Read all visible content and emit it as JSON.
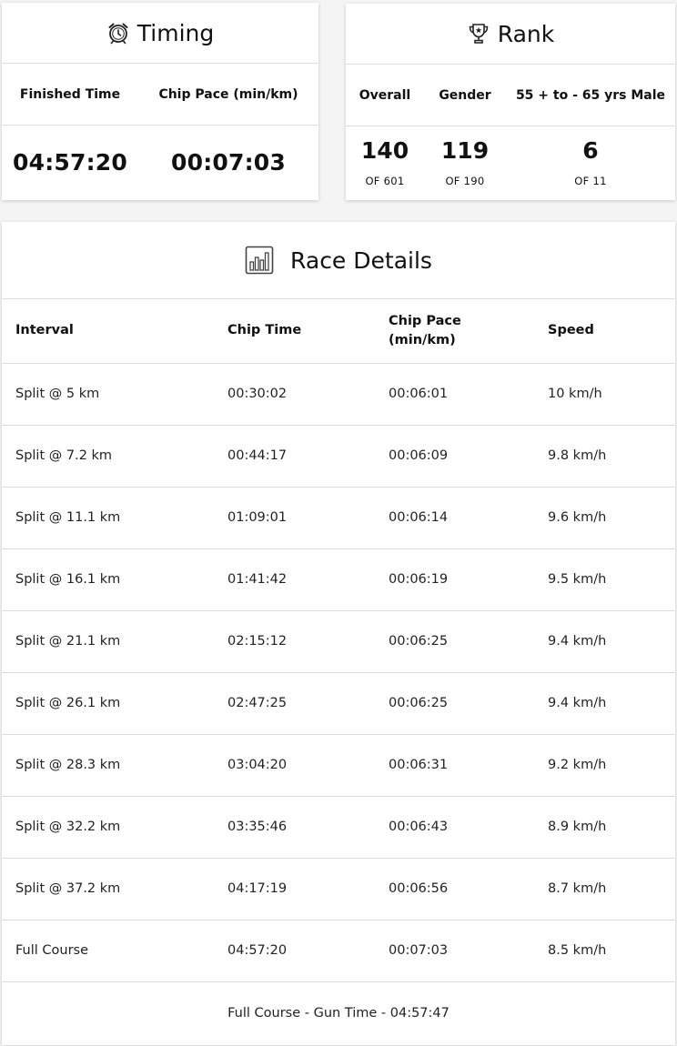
{
  "timing": {
    "title": "Timing",
    "icon": "alarm-clock-icon",
    "finished_time_label": "Finished Time",
    "chip_pace_label": "Chip Pace (min/km)",
    "finished_time": "04:57:20",
    "chip_pace": "00:07:03"
  },
  "rank": {
    "title": "Rank",
    "icon": "trophy-icon",
    "overall_label": "Overall",
    "gender_label": "Gender",
    "category_label": "55 + to - 65 yrs Male",
    "overall": "140",
    "overall_of": "OF 601",
    "gender": "119",
    "gender_of": "OF 190",
    "category": "6",
    "category_of": "OF 11"
  },
  "race_details": {
    "title": "Race Details",
    "icon": "bar-chart-icon",
    "columns": [
      "Interval",
      "Chip Time",
      "Chip Pace (min/km)",
      "Speed"
    ],
    "rows": [
      [
        "Split @ 5 km",
        "00:30:02",
        "00:06:01",
        "10 km/h"
      ],
      [
        "Split @ 7.2 km",
        "00:44:17",
        "00:06:09",
        "9.8 km/h"
      ],
      [
        "Split @ 11.1 km",
        "01:09:01",
        "00:06:14",
        "9.6 km/h"
      ],
      [
        "Split @ 16.1 km",
        "01:41:42",
        "00:06:19",
        "9.5 km/h"
      ],
      [
        "Split @ 21.1 km",
        "02:15:12",
        "00:06:25",
        "9.4 km/h"
      ],
      [
        "Split @ 26.1 km",
        "02:47:25",
        "00:06:25",
        "9.4 km/h"
      ],
      [
        "Split @ 28.3 km",
        "03:04:20",
        "00:06:31",
        "9.2 km/h"
      ],
      [
        "Split @ 32.2 km",
        "03:35:46",
        "00:06:43",
        "8.9 km/h"
      ],
      [
        "Split @ 37.2 km",
        "04:17:19",
        "00:06:56",
        "8.7 km/h"
      ],
      [
        "Full Course",
        "04:57:20",
        "00:07:03",
        "8.5 km/h"
      ]
    ],
    "gun_time_note": "Full Course - Gun Time - 04:57:47"
  }
}
